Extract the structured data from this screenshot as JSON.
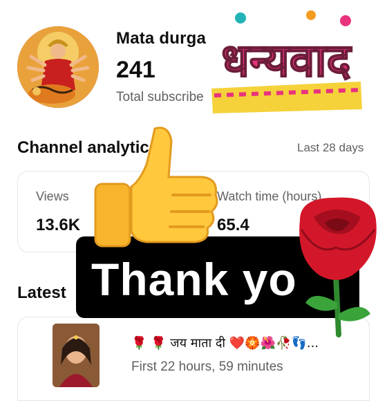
{
  "channel": {
    "name": "Mata durga",
    "subscriber_count": "241",
    "subscriber_label": "Total subscribe"
  },
  "sticker": {
    "text": "धन्यवाद"
  },
  "analytics": {
    "title": "Channel analytic",
    "period": "Last 28 days",
    "views_label": "Views",
    "views_value": "13.6K",
    "watch_label": "Watch time (hours)",
    "watch_value": "65.4"
  },
  "overlay": {
    "thank_you": "Thank yo"
  },
  "latest": {
    "title": "Latest",
    "video_title": "🌹 🌹 जय माता दी ❤️🏵️🌺🥀👣...",
    "video_meta": "First 22 hours, 59 minutes"
  },
  "colors": {
    "sticker_pink": "#e8337d",
    "sticker_teal": "#22b3b8",
    "thumbs_yellow": "#ffc83d",
    "rose_red": "#d3172a"
  }
}
